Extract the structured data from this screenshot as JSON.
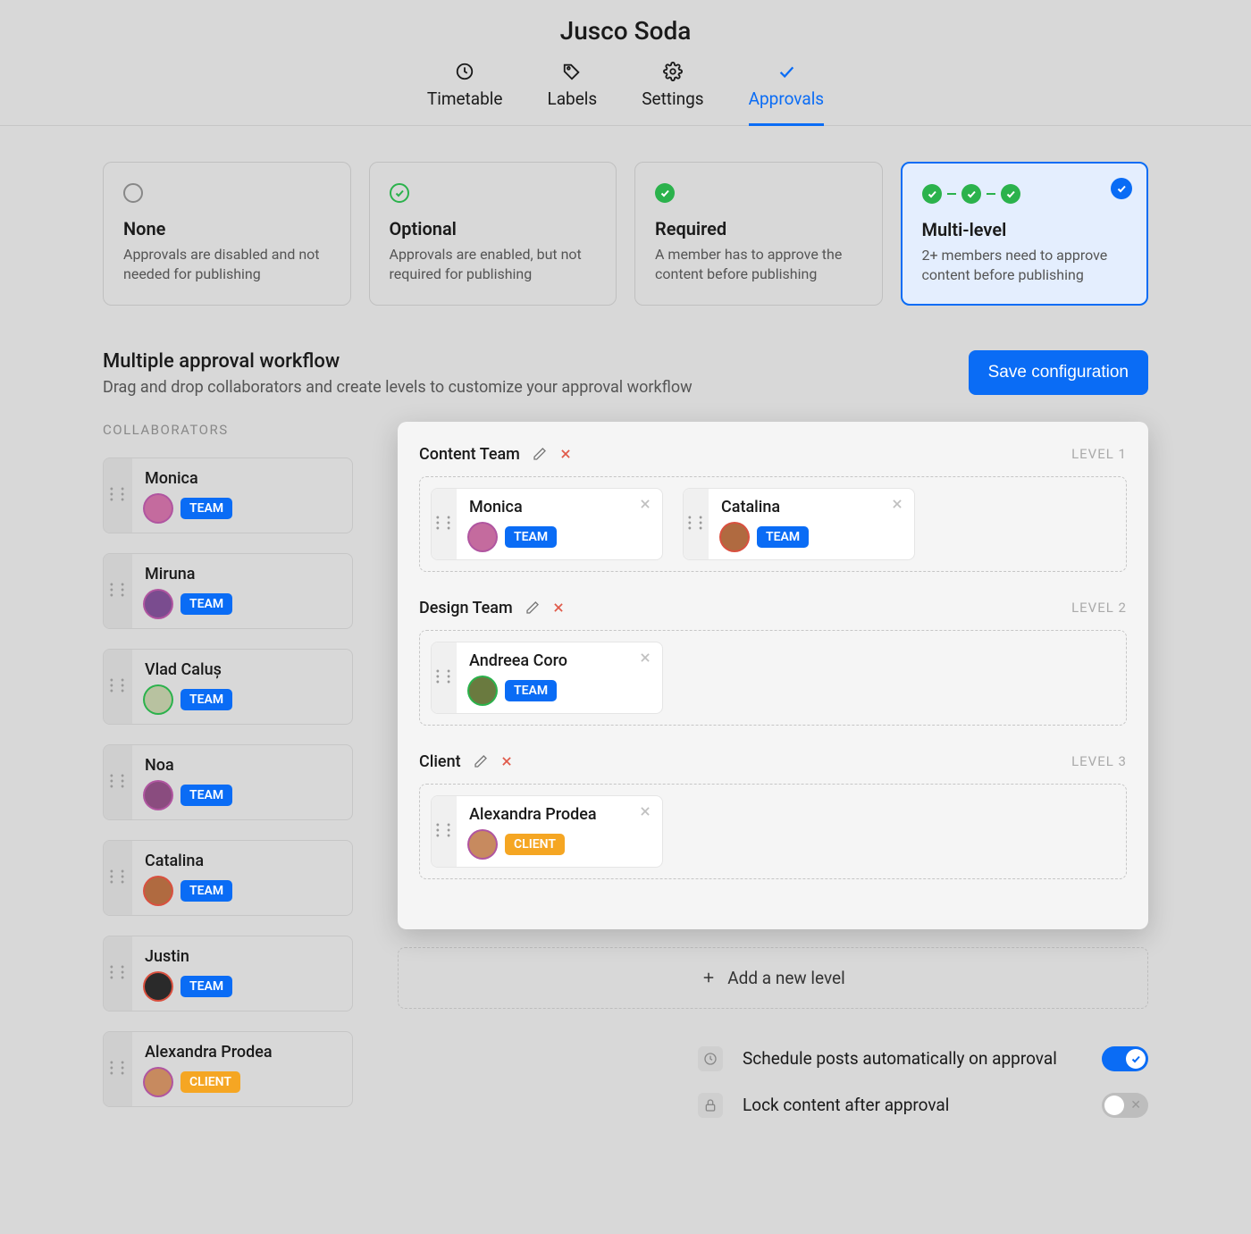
{
  "header": {
    "title": "Jusco Soda",
    "tabs": [
      {
        "label": "Timetable",
        "icon": "clock-icon",
        "active": false
      },
      {
        "label": "Labels",
        "icon": "tag-icon",
        "active": false
      },
      {
        "label": "Settings",
        "icon": "gear-icon",
        "active": false
      },
      {
        "label": "Approvals",
        "icon": "check-icon",
        "active": true
      }
    ]
  },
  "options": [
    {
      "key": "none",
      "title": "None",
      "desc": "Approvals are disabled and not needed for publishing",
      "selected": false
    },
    {
      "key": "optional",
      "title": "Optional",
      "desc": "Approvals are enabled, but not required for publishing",
      "selected": false
    },
    {
      "key": "required",
      "title": "Required",
      "desc": "A member has to approve the content before publishing",
      "selected": false
    },
    {
      "key": "multi",
      "title": "Multi-level",
      "desc": "2+ members need to approve content before publishing",
      "selected": true
    }
  ],
  "workflow": {
    "heading": "Multiple approval workflow",
    "subheading": "Drag and drop collaborators and create levels to customize your approval workflow",
    "save_label": "Save configuration",
    "collaborators_label": "COLLABORATORS",
    "add_level_label": "Add a new level"
  },
  "collaborators": [
    {
      "name": "Monica",
      "role": "TEAM",
      "avatar_color": "#c46b9e",
      "ring": "#b055a0"
    },
    {
      "name": "Miruna",
      "role": "TEAM",
      "avatar_color": "#7a4c8f",
      "ring": "#b055a0"
    },
    {
      "name": "Vlad Caluș",
      "role": "TEAM",
      "avatar_color": "#b8c2a0",
      "ring": "#2bb24c"
    },
    {
      "name": "Noa",
      "role": "TEAM",
      "avatar_color": "#8a4c7f",
      "ring": "#b055a0"
    },
    {
      "name": "Catalina",
      "role": "TEAM",
      "avatar_color": "#b06a40",
      "ring": "#d9503f"
    },
    {
      "name": "Justin",
      "role": "TEAM",
      "avatar_color": "#2a2a2a",
      "ring": "#d9503f"
    },
    {
      "name": "Alexandra Prodea",
      "role": "CLIENT",
      "avatar_color": "#c78a5f",
      "ring": "#b055a0"
    }
  ],
  "levels": [
    {
      "title": "Content Team",
      "tag": "LEVEL 1",
      "members": [
        {
          "name": "Monica",
          "role": "TEAM",
          "avatar_color": "#c46b9e",
          "ring": "#b055a0"
        },
        {
          "name": "Catalina",
          "role": "TEAM",
          "avatar_color": "#b06a40",
          "ring": "#d9503f"
        }
      ]
    },
    {
      "title": "Design Team",
      "tag": "LEVEL 2",
      "members": [
        {
          "name": "Andreea Coro",
          "role": "TEAM",
          "avatar_color": "#6a7a3f",
          "ring": "#2bb24c"
        }
      ]
    },
    {
      "title": "Client",
      "tag": "LEVEL 3",
      "members": [
        {
          "name": "Alexandra Prodea",
          "role": "CLIENT",
          "avatar_color": "#c78a5f",
          "ring": "#b055a0"
        }
      ]
    }
  ],
  "settings": [
    {
      "icon": "clock-icon",
      "label": "Schedule posts automatically on approval",
      "on": true
    },
    {
      "icon": "lock-icon",
      "label": "Lock content after approval",
      "on": false
    }
  ]
}
